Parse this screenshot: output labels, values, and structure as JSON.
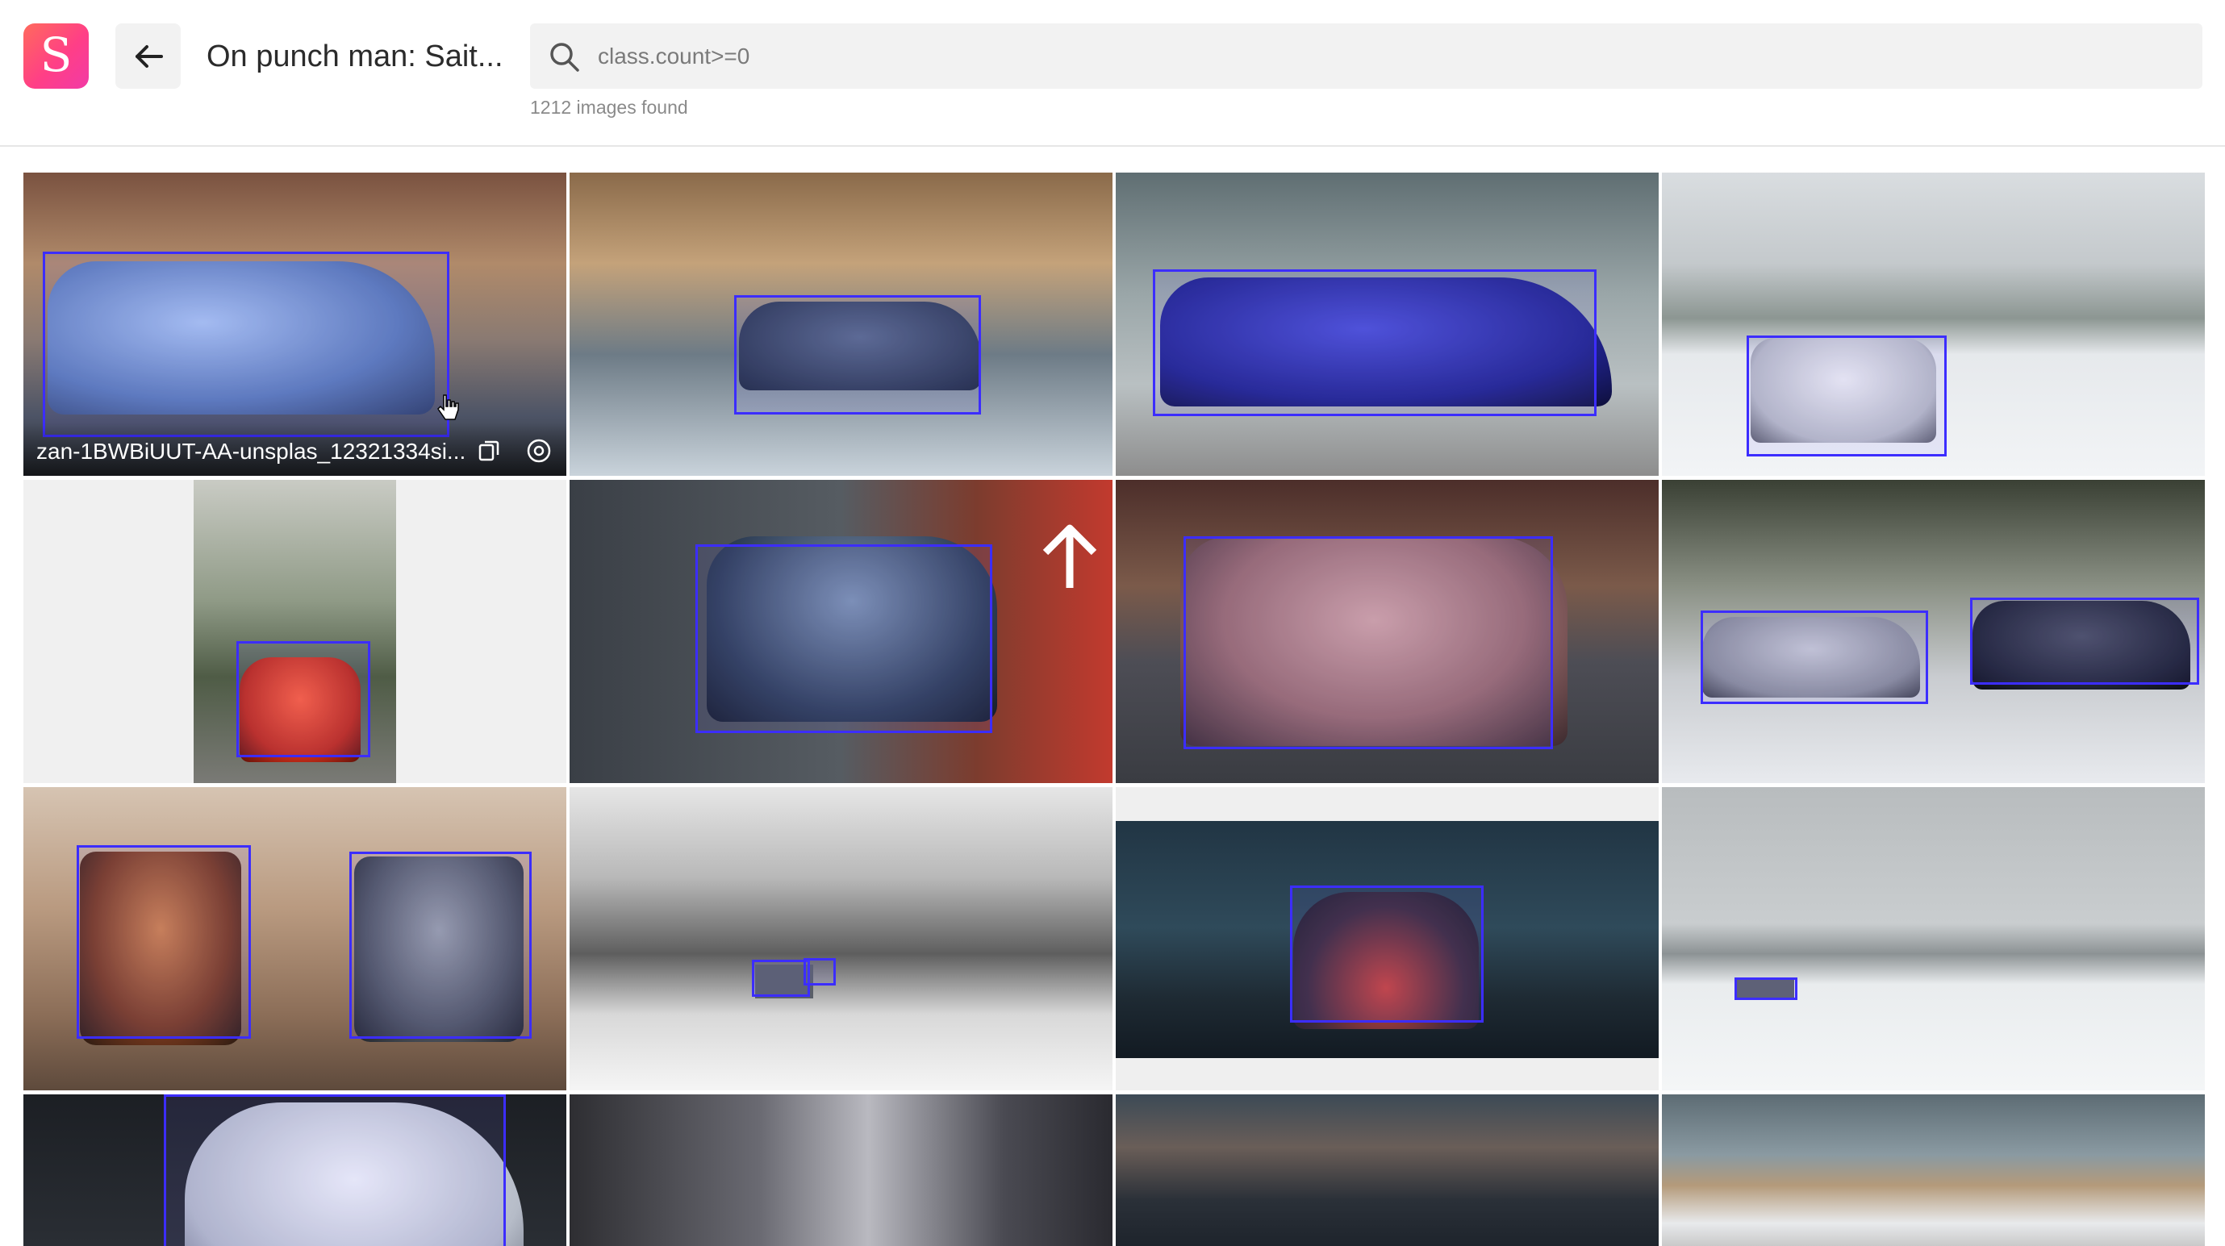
{
  "header": {
    "logo_letter": "S",
    "back_icon": "arrow-left-icon",
    "title": "On punch man: Sait...",
    "search": {
      "value": "class.count>=0",
      "placeholder": "class.count>=0",
      "icon": "search-icon"
    },
    "result_count": "1212 images found"
  },
  "gallery": {
    "hovered_tile": {
      "filename": "zan-1BWBiUUT-AA-unsplas_12321334si...",
      "copy_icon": "copy-icon",
      "info_icon": "info-icon"
    },
    "colors": {
      "box_border": "#3c2dff",
      "logo_gradient_start": "#ff6a5c",
      "logo_gradient_end": "#f23aa6"
    }
  }
}
